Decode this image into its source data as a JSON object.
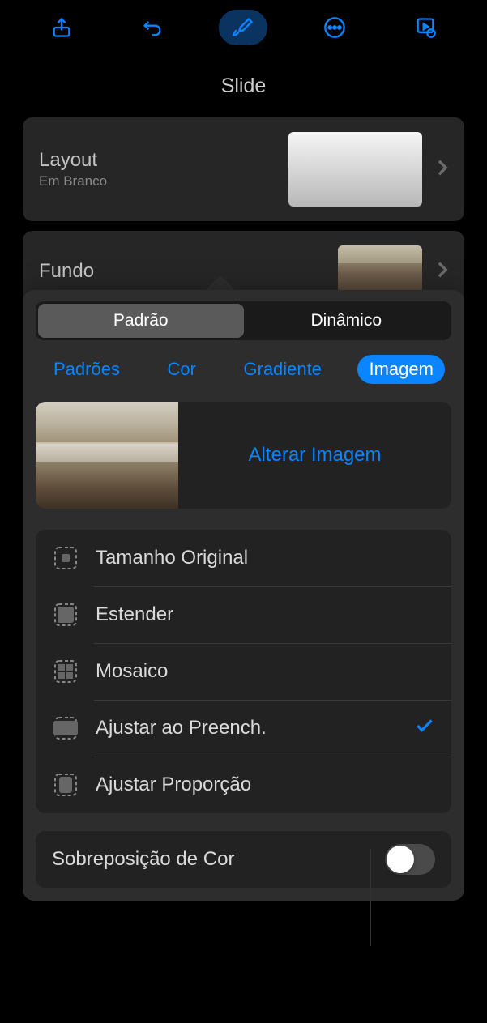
{
  "panel": {
    "title": "Slide"
  },
  "layout": {
    "label": "Layout",
    "sublabel": "Em Branco"
  },
  "background": {
    "label": "Fundo"
  },
  "segmented": {
    "items": [
      "Padrão",
      "Dinâmico"
    ],
    "selectedIndex": 0
  },
  "tabs": {
    "items": [
      "Padrões",
      "Cor",
      "Gradiente",
      "Imagem"
    ],
    "selectedIndex": 3
  },
  "image": {
    "changeLabel": "Alterar Imagem"
  },
  "scaleOptions": {
    "items": [
      "Tamanho Original",
      "Estender",
      "Mosaico",
      "Ajustar ao Preench.",
      "Ajustar Proporção"
    ],
    "selectedIndex": 3
  },
  "overlay": {
    "label": "Sobreposição de Cor",
    "enabled": false
  },
  "colors": {
    "accent": "#0a84ff"
  }
}
